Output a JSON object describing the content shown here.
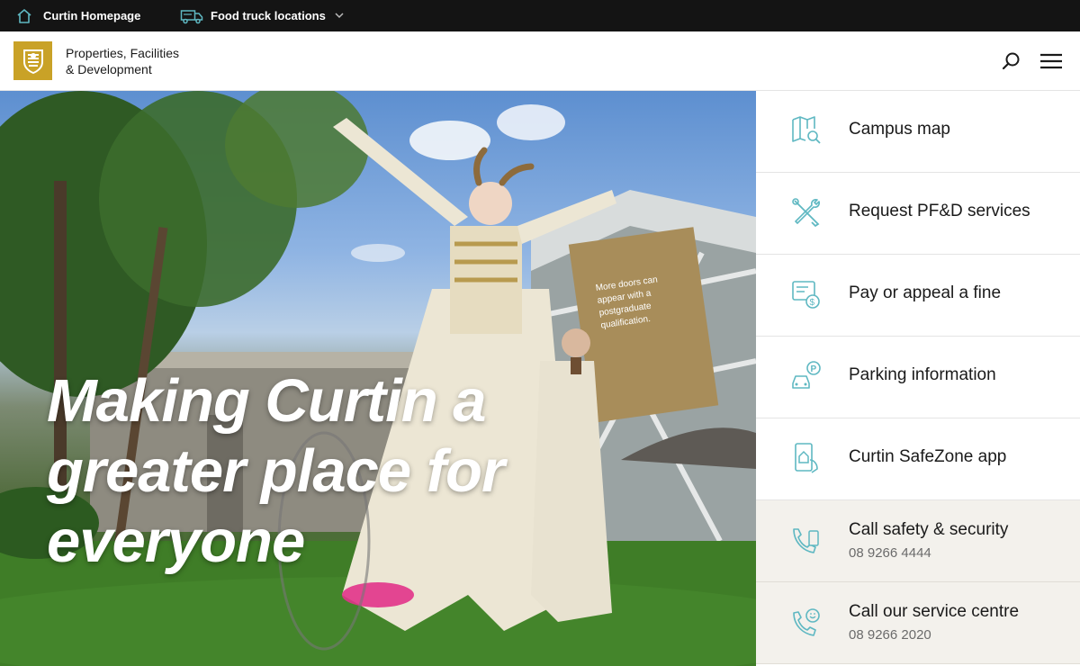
{
  "topbar": {
    "home_label": "Curtin Homepage",
    "food_label": "Food truck locations"
  },
  "header": {
    "title_line1": "Properties, Facilities",
    "title_line2": "& Development"
  },
  "hero": {
    "headline_line1": "Making Curtin a",
    "headline_line2": "greater place for",
    "headline_line3": "everyone",
    "billboard_text": "More doors can appear with a postgraduate qualification."
  },
  "quick_links": [
    {
      "label": "Campus map",
      "icon": "map-search-icon"
    },
    {
      "label": "Request PF&D services",
      "icon": "tools-icon"
    },
    {
      "label": "Pay or appeal a fine",
      "icon": "fine-dollar-icon"
    },
    {
      "label": "Parking information",
      "icon": "parking-car-icon"
    },
    {
      "label": "Curtin SafeZone app",
      "icon": "safezone-app-icon"
    },
    {
      "label": "Call safety & security",
      "sub": "08 9266 4444",
      "icon": "phone-shield-icon"
    },
    {
      "label": "Call our service centre",
      "sub": "08 9266 2020",
      "icon": "phone-smile-icon"
    }
  ],
  "colors": {
    "topbar_bg": "#141414",
    "logo_gold": "#c9a227",
    "icon_teal": "#5fb8c2",
    "alt_row_bg": "#f3f1ec"
  }
}
